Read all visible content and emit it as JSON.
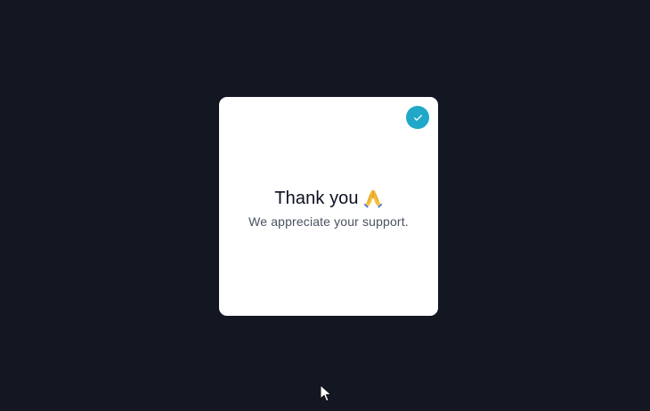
{
  "colors": {
    "background": "#121722",
    "card": "#ffffff",
    "accent": "#20a8c8"
  },
  "card": {
    "title": "Thank you",
    "title_emoji": "🙏",
    "subtitle": "We appreciate your support.",
    "badge_icon": "check-icon",
    "emoji_icon": "folded-hands-icon"
  },
  "pointer": {
    "icon": "mouse-pointer-icon"
  }
}
